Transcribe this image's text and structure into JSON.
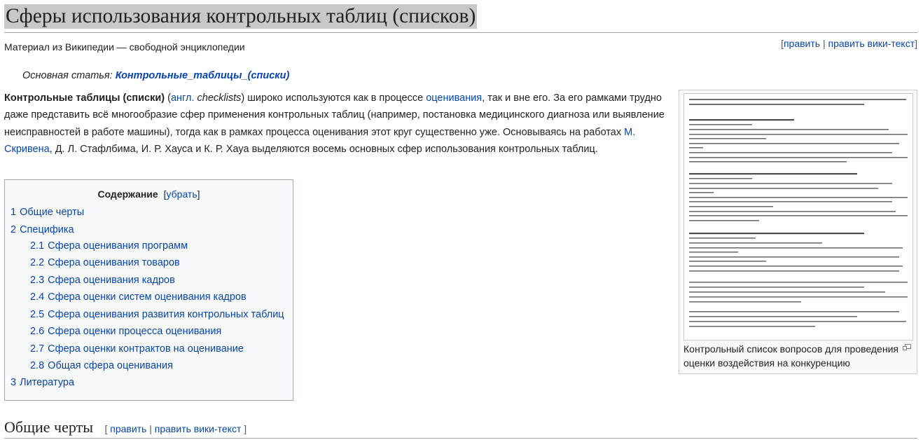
{
  "page": {
    "title": "Сферы использования контрольных таблиц (списков)",
    "site_sub": "Материал из Википедии — свободной энциклопедии",
    "edit_label": "править",
    "edit_source_label": "править вики-текст",
    "hatnote_prefix": "Основная статья: ",
    "hatnote_link": "Контрольные_таблицы_(списки)"
  },
  "intro": {
    "bold_term": "Контрольные таблицы (списки)",
    "paren_open": " (",
    "lang_link": "англ.",
    "lang_term": " checklists",
    "paren_close": ")",
    "text1": " широко используются как в процессе ",
    "link_evaluation": "оценивания",
    "text2": ", так и вне его. За его рамками трудно даже представить всё многообразие сфер применения контрольных таблиц (например, постановка медицинского диагноза или выявление неисправностей в работе машины), тогда как в рамках процесса оценивания этот круг существенно уже. Основываясь на работах ",
    "link_scriven": "М. Скривена",
    "text3": ", Д. Л. Стафлбима, И. Р. Хауса и К. Р. Хауа выделяются восемь основных сфер использования контрольных таблиц."
  },
  "toc": {
    "title": "Содержание",
    "toggle_open": "[",
    "toggle_label": "убрать",
    "toggle_close": "]",
    "items": [
      {
        "num": "1",
        "label": "Общие черты"
      },
      {
        "num": "2",
        "label": "Специфика"
      },
      {
        "num": "2.1",
        "label": "Сфера оценивания программ"
      },
      {
        "num": "2.2",
        "label": "Сфера оценивания товаров"
      },
      {
        "num": "2.3",
        "label": "Сфера оценивания кадров"
      },
      {
        "num": "2.4",
        "label": "Сфера оценки систем оценивания кадров"
      },
      {
        "num": "2.5",
        "label": "Сфера оценивания развития контрольных таблиц"
      },
      {
        "num": "2.6",
        "label": "Сфера оценки процесса оценивания"
      },
      {
        "num": "2.7",
        "label": "Сфера оценки контрактов на оценивание"
      },
      {
        "num": "2.8",
        "label": "Общая сфера оценивания"
      },
      {
        "num": "3",
        "label": "Литература"
      }
    ]
  },
  "figure": {
    "caption": "Контрольный список вопросов для проведения оценки воздействия на конкуренцию",
    "enlarge_icon": "magnify-clip-icon"
  },
  "section": {
    "title": "Общие черты",
    "edit_open": "[",
    "edit_label": "править",
    "edit_sep": "|",
    "edit_source_label": "править вики-текст",
    "edit_close": "]"
  }
}
